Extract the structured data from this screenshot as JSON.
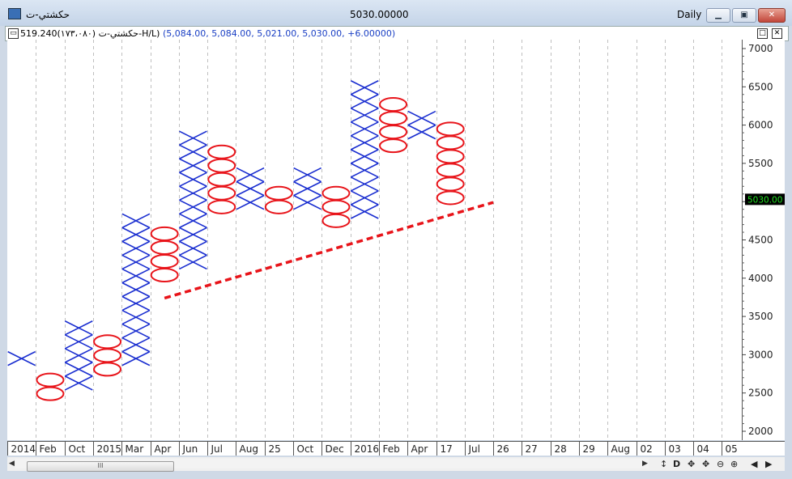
{
  "window": {
    "title_left": "حکشتي-ت",
    "title_center": "5030.00000",
    "title_right": "Daily",
    "min_icon": "minimize-icon",
    "restore_icon": "restore-icon",
    "close_icon": "close-icon"
  },
  "infobar": {
    "name": "حکشتي-ت (۱۷۳،۰۸۰)",
    "box_params": "519.240-H/L)",
    "values": "(5,084.00, 5,084.00, 5,021.00, 5,030.00, +6.00000)"
  },
  "scrollbar": {
    "grip": "III",
    "tools": [
      "↕",
      "D",
      "✥",
      "✥",
      "⊖",
      "⊕",
      "◀",
      "▶"
    ]
  },
  "chart_data": {
    "type": "point_and_figure",
    "ylim": [
      1900,
      7100
    ],
    "y_ticks": [
      2000,
      2500,
      3000,
      3500,
      4000,
      4500,
      5000,
      5500,
      6000,
      6500,
      7000
    ],
    "box_size": 180,
    "last_price": "5030.00",
    "last_price_value": 5030,
    "x_tick_labels": [
      "2014",
      "Feb",
      "Oct",
      "2015",
      "Mar",
      "Apr",
      "Jun",
      "Jul",
      "Aug",
      "25",
      "Oct",
      "Dec",
      "2016",
      "Feb",
      "Apr",
      "17",
      "Jul",
      "26",
      "27",
      "28",
      "29",
      "Aug",
      "02",
      "03",
      "04",
      "05"
    ],
    "columns": [
      {
        "type": "X",
        "low": 2860,
        "high": 3040
      },
      {
        "type": "O",
        "low": 2400,
        "high": 2840
      },
      {
        "type": "X",
        "low": 2540,
        "high": 3360
      },
      {
        "type": "O",
        "low": 2720,
        "high": 3170
      },
      {
        "type": "X",
        "low": 2860,
        "high": 4780
      },
      {
        "type": "O",
        "low": 3950,
        "high": 4580
      },
      {
        "type": "X",
        "low": 4120,
        "high": 5980
      },
      {
        "type": "O",
        "low": 4840,
        "high": 5740
      },
      {
        "type": "X",
        "low": 4900,
        "high": 5440
      },
      {
        "type": "O",
        "low": 4840,
        "high": 5260
      },
      {
        "type": "X",
        "low": 4900,
        "high": 5440
      },
      {
        "type": "O",
        "low": 4660,
        "high": 5260
      },
      {
        "type": "X",
        "low": 4780,
        "high": 6500
      },
      {
        "type": "O",
        "low": 5640,
        "high": 6280
      },
      {
        "type": "X",
        "low": 5820,
        "high": 6180
      },
      {
        "type": "O",
        "low": 4960,
        "high": 5960
      }
    ],
    "trendline": {
      "from": {
        "column": 5.5,
        "value": 3740
      },
      "to": {
        "column": 17,
        "value": 4990
      }
    }
  },
  "colors": {
    "x_color": "#1a2ed0",
    "o_color": "#e8141a",
    "trend_color": "#e8141a",
    "grid_color": "#bfbfbf",
    "price_tag_bg": "#000000",
    "price_tag_fg": "#21e021"
  }
}
